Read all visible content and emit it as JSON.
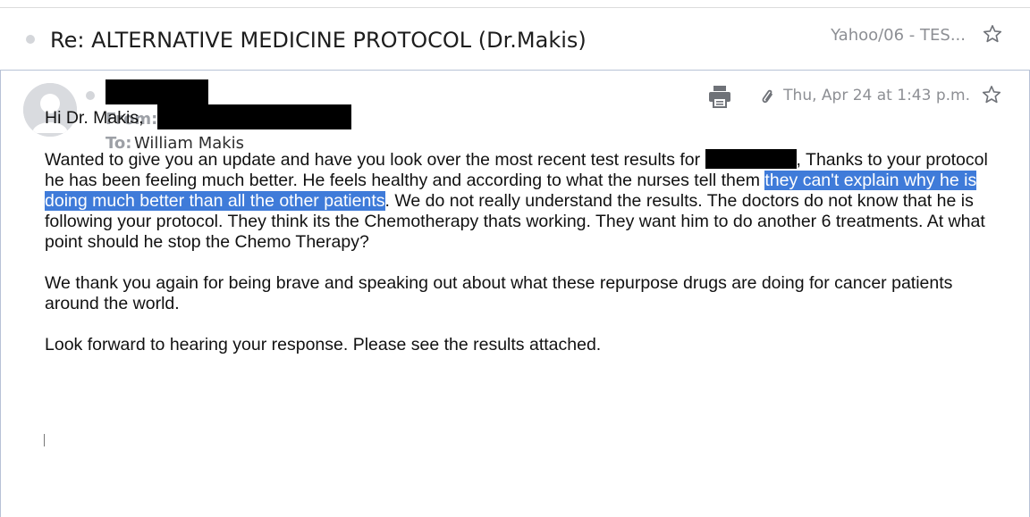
{
  "thread": {
    "subject": "Re: ALTERNATIVE MEDICINE PROTOCOL (Dr.Makis)",
    "folder": "Yahoo/06 - TES..."
  },
  "message": {
    "from_label": "From:",
    "to_label": "To:",
    "to_name": "William Makis",
    "date": "Thu, Apr 24 at 1:43 p.m.",
    "body": {
      "greeting": "Hi Dr. Makis,",
      "p1_a": "Wanted to give you an update and have you look over the most recent test results for ",
      "p1_b": ", Thanks to your protocol he has been feeling much better. He feels healthy and according to what the nurses tell them ",
      "p1_highlight": "they can't explain why he is doing much better than all the other patients",
      "p1_c": ". We do not really understand the results. The doctors do not know that he is following your protocol. They think its the Chemotherapy thats working. They want him to do another 6 treatments. At what point should he stop the Chemo Therapy?",
      "p2": "We thank you again for being brave and speaking out about what these repurpose drugs are doing for cancer patients around the world.",
      "p3": "Look forward to hearing your response. Please see the results attached."
    }
  },
  "icons": {
    "print": "printer-icon",
    "attachment": "paperclip-icon",
    "star": "star-outline-icon",
    "avatar": "default-avatar-icon"
  },
  "colors": {
    "highlight": "#3f7bd9",
    "muted_text": "#8d8f94",
    "card_border": "#b8c2d6"
  }
}
